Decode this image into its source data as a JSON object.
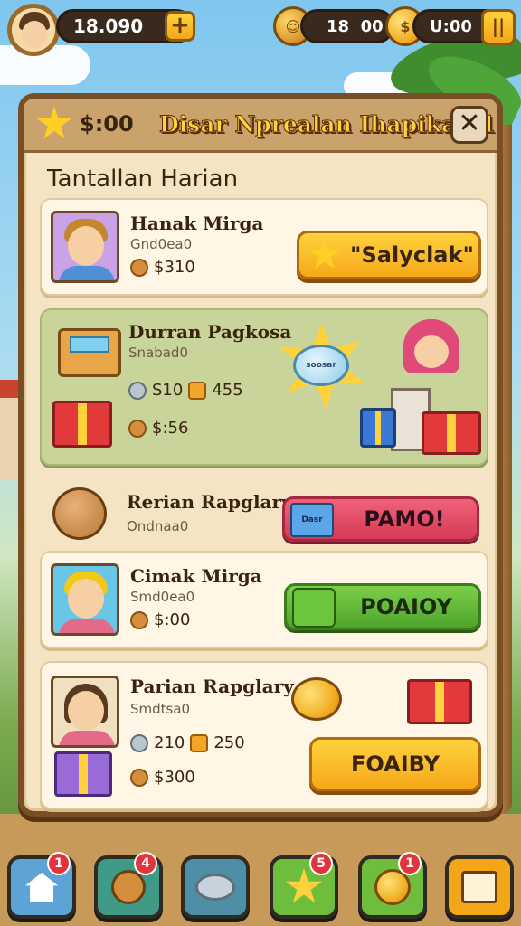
{
  "hud": {
    "currency_1": "18.090",
    "currency_2": "18  00",
    "timer": "U:00",
    "plus_label": "+"
  },
  "panel": {
    "header_score": "$:00",
    "title": "Disar Nprealan Ihapikan 1",
    "close_label": "✕",
    "section_title": "Tantallan Harian"
  },
  "cards": [
    {
      "name": "Hanak Mirga",
      "subtitle": "Gnd0ea0",
      "reward_1": "$310",
      "button_label": "\"Salyclak\""
    },
    {
      "name": "Durran Pagkosa",
      "subtitle": "Snabad0",
      "reward_1": "S10",
      "reward_2": "455",
      "reward_3": "$:56",
      "banner_label": "soosar"
    },
    {
      "name": "Rerian Rapglary",
      "subtitle": "Ondnaa0",
      "chest_label": "Dasr",
      "button_label": "PAMO!"
    },
    {
      "name": "Cimak Mirga",
      "subtitle": "Smd0ea0",
      "reward_1": "$:00",
      "button_label": "POAIOY"
    },
    {
      "name": "Parian Rapglary",
      "subtitle": "Smdtsa0",
      "reward_1": "210",
      "reward_2": "250",
      "reward_3": "$300",
      "button_label": "FOAIBY"
    }
  ],
  "nav": [
    {
      "icon": "home-icon",
      "badge": "1",
      "color": "#5ea3d6"
    },
    {
      "icon": "cookie-icon",
      "badge": "4",
      "color": "#3f9a86"
    },
    {
      "icon": "gem-icon",
      "badge": "",
      "color": "#4f8fa6"
    },
    {
      "icon": "star-icon",
      "badge": "5",
      "color": "#6fbd3c"
    },
    {
      "icon": "coin-icon",
      "badge": "1",
      "color": "#6fbd3c"
    },
    {
      "icon": "calendar-icon",
      "badge": "",
      "color": "#f3a617"
    }
  ]
}
